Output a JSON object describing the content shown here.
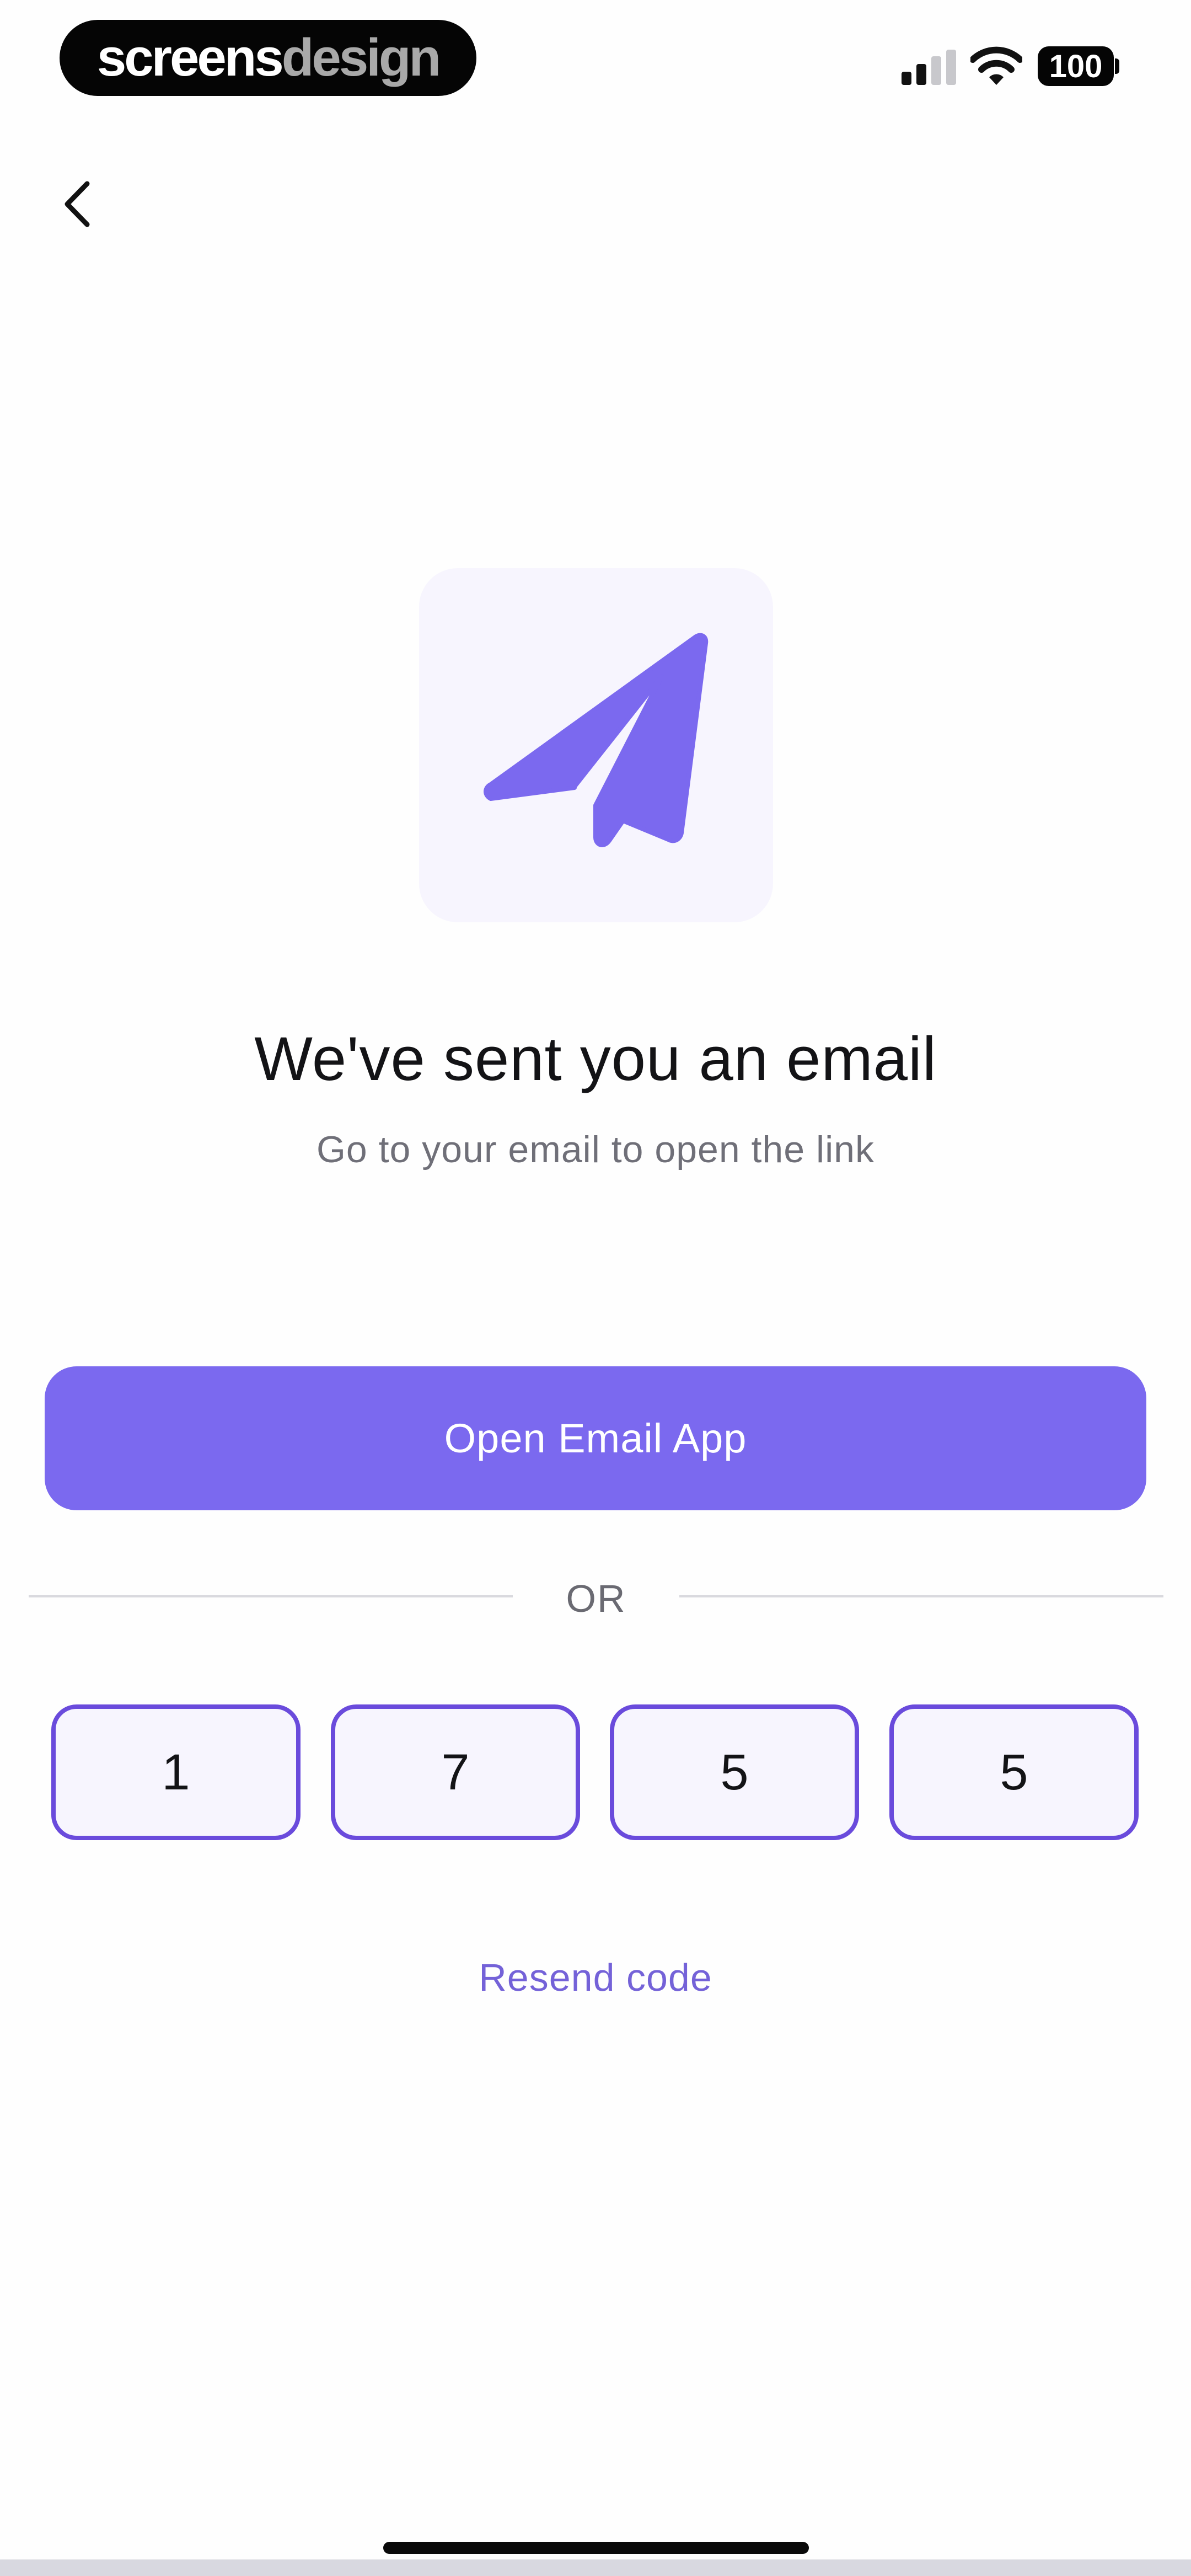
{
  "status_bar": {
    "brand_part1": "screens",
    "brand_part2": "design",
    "battery_level": "100",
    "signal_icon": "signal-bars-icon",
    "wifi_icon": "wifi-icon"
  },
  "nav": {
    "back_icon": "chevron-left-icon"
  },
  "hero": {
    "icon": "paper-plane-icon",
    "accent_color": "#7b69ef",
    "tile_color": "#f7f5fe"
  },
  "content": {
    "title": "We've sent you an email",
    "subtitle": "Go to your email to open the link"
  },
  "actions": {
    "open_email_label": "Open Email App",
    "divider_label": "OR",
    "resend_label": "Resend code"
  },
  "code": {
    "digits": [
      "1",
      "7",
      "5",
      "5"
    ],
    "border_color": "#6a4bdc"
  }
}
